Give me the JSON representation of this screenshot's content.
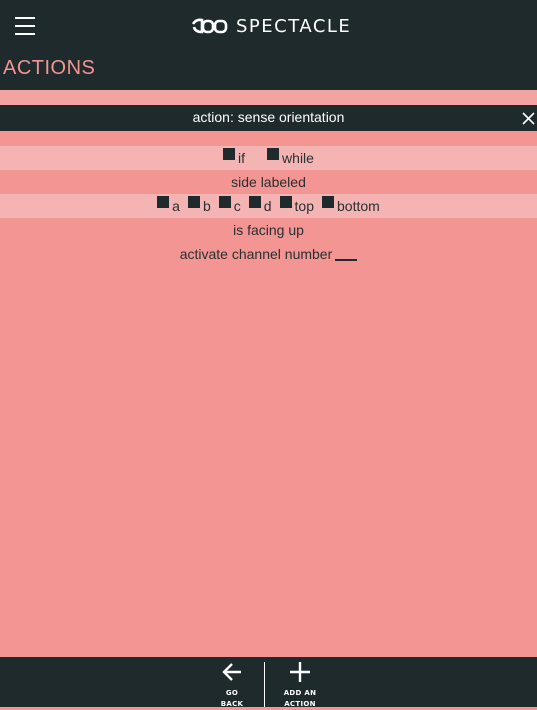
{
  "app": {
    "brand": "SPECTACLE",
    "section_title": "ACTIONS"
  },
  "action": {
    "title": "action: sense orientation"
  },
  "rows": {
    "mode_options": [
      "if",
      "while"
    ],
    "side_labeled_text": "side labeled",
    "side_options": [
      "a",
      "b",
      "c",
      "d",
      "top",
      "bottom"
    ],
    "facing_text": "is facing up",
    "activate_text": "activate channel number"
  },
  "footer": {
    "go_back_label": "GO BACK",
    "add_action_label": "ADD AN ACTION"
  },
  "colors": {
    "dark": "#1e2a2c",
    "pink": "#f29593",
    "light_pink": "#f5b4b4"
  }
}
